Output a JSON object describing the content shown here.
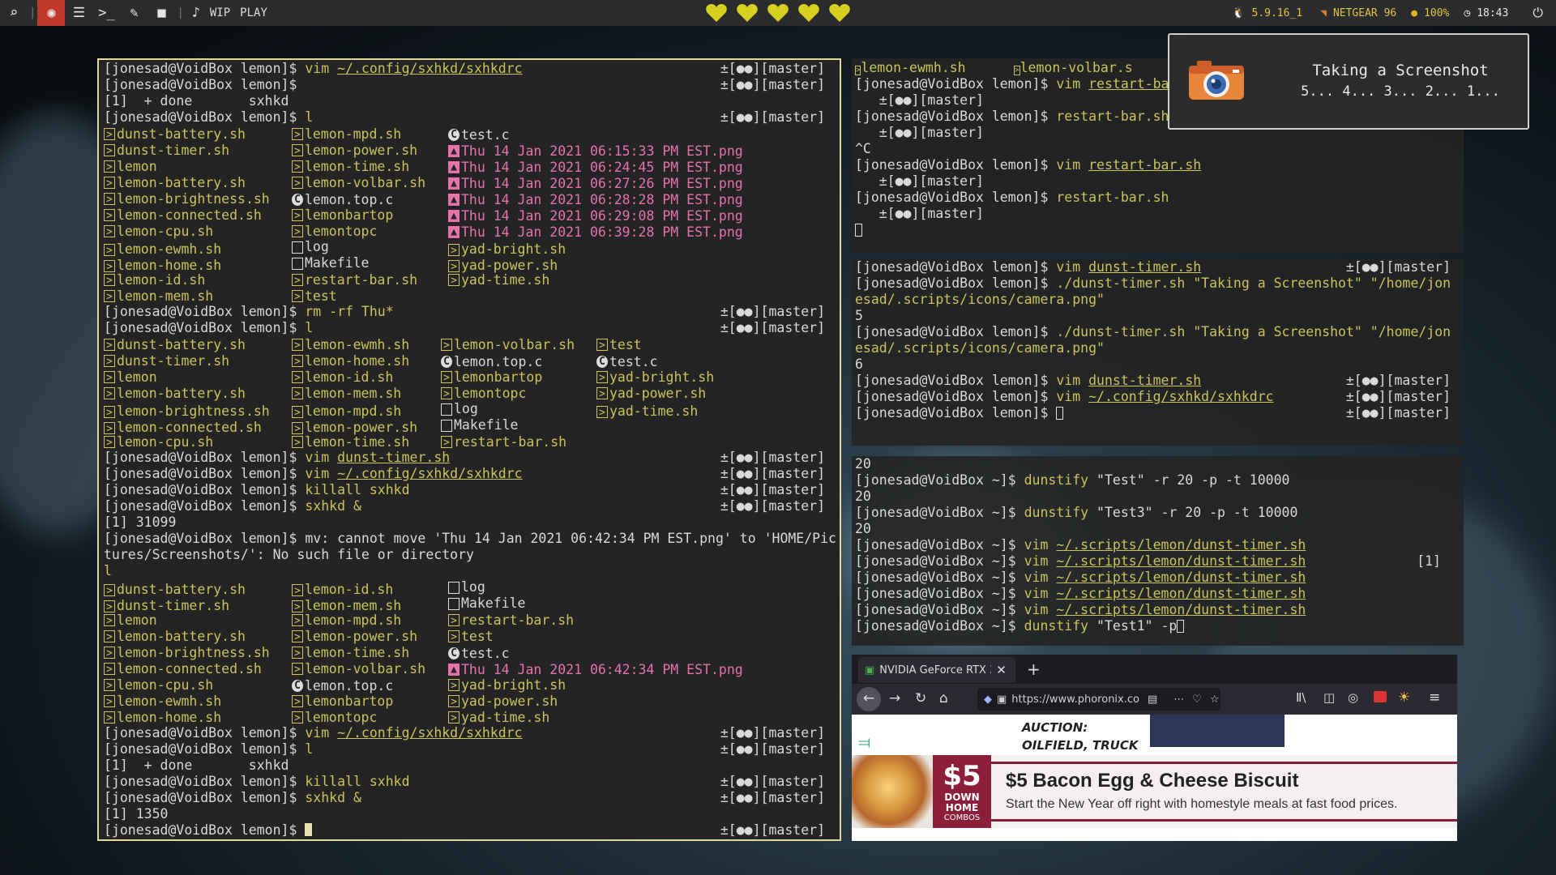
{
  "topbar": {
    "workspace_labels": [
      "WIP",
      "PLAY"
    ],
    "kernel": "5.9.16_1",
    "wifi": "NETGEAR 96",
    "battery": "100%",
    "time": "18:43",
    "hearts_count": 5,
    "accent": "#c0392b",
    "heart_color": "#d8d020"
  },
  "notification": {
    "title": "Taking a Screenshot",
    "body": "5... 4... 3... 2... 1..."
  },
  "left_terminal": {
    "prompt": "[jonesad@VoidBox lemon]$ ",
    "git": "±[●●][master]",
    "lines": [
      {
        "t": "cmd",
        "cmd": "vim",
        "arg": "~/.config/sxhkd/sxhkdrc",
        "argstyle": "ul",
        "git": true
      },
      {
        "t": "cmd",
        "cmd": "",
        "arg": "",
        "git": true
      },
      {
        "t": "out",
        "text": "[1]  + done       sxhkd"
      },
      {
        "t": "cmd",
        "cmd": "l",
        "arg": "",
        "git": true
      },
      {
        "t": "cols",
        "cells": [
          [
            "sh",
            "dunst-battery.sh"
          ],
          [
            "sh",
            "lemon-mpd.sh"
          ],
          [
            "c",
            "test.c"
          ]
        ]
      },
      {
        "t": "cols",
        "cells": [
          [
            "sh",
            "dunst-timer.sh"
          ],
          [
            "sh",
            "lemon-power.sh"
          ],
          [
            "png",
            "Thu 14 Jan 2021 06:15:33 PM EST.png"
          ]
        ]
      },
      {
        "t": "cols",
        "cells": [
          [
            "sh",
            "lemon"
          ],
          [
            "sh",
            "lemon-time.sh"
          ],
          [
            "png",
            "Thu 14 Jan 2021 06:24:45 PM EST.png"
          ]
        ]
      },
      {
        "t": "cols",
        "cells": [
          [
            "sh",
            "lemon-battery.sh"
          ],
          [
            "sh",
            "lemon-volbar.sh"
          ],
          [
            "png",
            "Thu 14 Jan 2021 06:27:26 PM EST.png"
          ]
        ]
      },
      {
        "t": "cols",
        "cells": [
          [
            "sh",
            "lemon-brightness.sh"
          ],
          [
            "c",
            "lemon.top.c"
          ],
          [
            "png",
            "Thu 14 Jan 2021 06:28:28 PM EST.png"
          ]
        ]
      },
      {
        "t": "cols",
        "cells": [
          [
            "sh",
            "lemon-connected.sh"
          ],
          [
            "sh",
            "lemonbartop"
          ],
          [
            "png",
            "Thu 14 Jan 2021 06:29:08 PM EST.png"
          ]
        ]
      },
      {
        "t": "cols",
        "cells": [
          [
            "sh",
            "lemon-cpu.sh"
          ],
          [
            "sh",
            "lemontopc"
          ],
          [
            "png",
            "Thu 14 Jan 2021 06:39:28 PM EST.png"
          ]
        ]
      },
      {
        "t": "cols",
        "cells": [
          [
            "sh",
            "lemon-ewmh.sh"
          ],
          [
            "file",
            "log"
          ],
          [
            "sh",
            "yad-bright.sh"
          ]
        ]
      },
      {
        "t": "cols",
        "cells": [
          [
            "sh",
            "lemon-home.sh"
          ],
          [
            "file",
            "Makefile"
          ],
          [
            "sh",
            "yad-power.sh"
          ]
        ]
      },
      {
        "t": "cols",
        "cells": [
          [
            "sh",
            "lemon-id.sh"
          ],
          [
            "sh",
            "restart-bar.sh"
          ],
          [
            "sh",
            "yad-time.sh"
          ]
        ]
      },
      {
        "t": "cols",
        "cells": [
          [
            "sh",
            "lemon-mem.sh"
          ],
          [
            "sh",
            "test"
          ]
        ]
      },
      {
        "t": "cmd",
        "cmd": "rm",
        "arg": "-rf Thu*",
        "argstyle": "plain",
        "git": true
      },
      {
        "t": "cmd",
        "cmd": "l",
        "arg": "",
        "git": true
      },
      {
        "t": "cols4",
        "cells": [
          [
            "sh",
            "dunst-battery.sh"
          ],
          [
            "sh",
            "lemon-ewmh.sh"
          ],
          [
            "sh",
            "lemon-volbar.sh"
          ],
          [
            "sh",
            "test"
          ]
        ]
      },
      {
        "t": "cols4",
        "cells": [
          [
            "sh",
            "dunst-timer.sh"
          ],
          [
            "sh",
            "lemon-home.sh"
          ],
          [
            "c",
            "lemon.top.c"
          ],
          [
            "c",
            "test.c"
          ]
        ]
      },
      {
        "t": "cols4",
        "cells": [
          [
            "sh",
            "lemon"
          ],
          [
            "sh",
            "lemon-id.sh"
          ],
          [
            "sh",
            "lemonbartop"
          ],
          [
            "sh",
            "yad-bright.sh"
          ]
        ]
      },
      {
        "t": "cols4",
        "cells": [
          [
            "sh",
            "lemon-battery.sh"
          ],
          [
            "sh",
            "lemon-mem.sh"
          ],
          [
            "sh",
            "lemontopc"
          ],
          [
            "sh",
            "yad-power.sh"
          ]
        ]
      },
      {
        "t": "cols4",
        "cells": [
          [
            "sh",
            "lemon-brightness.sh"
          ],
          [
            "sh",
            "lemon-mpd.sh"
          ],
          [
            "file",
            "log"
          ],
          [
            "sh",
            "yad-time.sh"
          ]
        ]
      },
      {
        "t": "cols4",
        "cells": [
          [
            "sh",
            "lemon-connected.sh"
          ],
          [
            "sh",
            "lemon-power.sh"
          ],
          [
            "file",
            "Makefile"
          ]
        ]
      },
      {
        "t": "cols4",
        "cells": [
          [
            "sh",
            "lemon-cpu.sh"
          ],
          [
            "sh",
            "lemon-time.sh"
          ],
          [
            "sh",
            "restart-bar.sh"
          ]
        ]
      },
      {
        "t": "cmd",
        "cmd": "vim",
        "arg": "dunst-timer.sh",
        "argstyle": "ul",
        "git": true
      },
      {
        "t": "cmd",
        "cmd": "vim",
        "arg": "~/.config/sxhkd/sxhkdrc",
        "argstyle": "ul",
        "git": true
      },
      {
        "t": "cmd",
        "cmd": "killall",
        "arg": "sxhkd",
        "argstyle": "plain",
        "git": true
      },
      {
        "t": "cmd",
        "cmd": "sxhkd",
        "arg": "&",
        "argstyle": "plain",
        "git": true
      },
      {
        "t": "out",
        "text": "[1] 31099"
      },
      {
        "t": "out",
        "text": "[jonesad@VoidBox lemon]$ mv: cannot move 'Thu 14 Jan 2021 06:42:34 PM EST.png' to 'HOME/Pic"
      },
      {
        "t": "out",
        "text": "tures/Screenshots/': No such file or directory"
      },
      {
        "t": "out",
        "text": "l",
        "cls": "yl"
      },
      {
        "t": "cols",
        "cells": [
          [
            "sh",
            "dunst-battery.sh"
          ],
          [
            "sh",
            "lemon-id.sh"
          ],
          [
            "file",
            "log"
          ]
        ]
      },
      {
        "t": "cols",
        "cells": [
          [
            "sh",
            "dunst-timer.sh"
          ],
          [
            "sh",
            "lemon-mem.sh"
          ],
          [
            "file",
            "Makefile"
          ]
        ]
      },
      {
        "t": "cols",
        "cells": [
          [
            "sh",
            "lemon"
          ],
          [
            "sh",
            "lemon-mpd.sh"
          ],
          [
            "sh",
            "restart-bar.sh"
          ]
        ]
      },
      {
        "t": "cols",
        "cells": [
          [
            "sh",
            "lemon-battery.sh"
          ],
          [
            "sh",
            "lemon-power.sh"
          ],
          [
            "sh",
            "test"
          ]
        ]
      },
      {
        "t": "cols",
        "cells": [
          [
            "sh",
            "lemon-brightness.sh"
          ],
          [
            "sh",
            "lemon-time.sh"
          ],
          [
            "c",
            "test.c"
          ]
        ]
      },
      {
        "t": "cols",
        "cells": [
          [
            "sh",
            "lemon-connected.sh"
          ],
          [
            "sh",
            "lemon-volbar.sh"
          ],
          [
            "png",
            "Thu 14 Jan 2021 06:42:34 PM EST.png"
          ]
        ]
      },
      {
        "t": "cols",
        "cells": [
          [
            "sh",
            "lemon-cpu.sh"
          ],
          [
            "c",
            "lemon.top.c"
          ],
          [
            "sh",
            "yad-bright.sh"
          ]
        ]
      },
      {
        "t": "cols",
        "cells": [
          [
            "sh",
            "lemon-ewmh.sh"
          ],
          [
            "sh",
            "lemonbartop"
          ],
          [
            "sh",
            "yad-power.sh"
          ]
        ]
      },
      {
        "t": "cols",
        "cells": [
          [
            "sh",
            "lemon-home.sh"
          ],
          [
            "sh",
            "lemontopc"
          ],
          [
            "sh",
            "yad-time.sh"
          ]
        ]
      },
      {
        "t": "cmd",
        "cmd": "vim",
        "arg": "~/.config/sxhkd/sxhkdrc",
        "argstyle": "ul",
        "git": true
      },
      {
        "t": "cmd",
        "cmd": "l",
        "arg": "",
        "git": true
      },
      {
        "t": "out",
        "text": "[1]  + done       sxhkd"
      },
      {
        "t": "cmd",
        "cmd": "killall",
        "arg": "sxhkd",
        "argstyle": "plain",
        "git": true
      },
      {
        "t": "cmd",
        "cmd": "sxhkd",
        "arg": "&",
        "argstyle": "plain",
        "git": true
      },
      {
        "t": "out",
        "text": "[1] 1350"
      },
      {
        "t": "cursor",
        "git": true
      }
    ]
  },
  "term_top_right": {
    "lines": [
      {
        "t": "raw",
        "segs": [
          [
            "sh-icon",
            ""
          ],
          [
            "yl",
            "lemon-ewmh.sh"
          ],
          [
            "",
            "      "
          ],
          [
            "sh-icon",
            ""
          ],
          [
            "yl",
            "lemon-volbar.s"
          ]
        ]
      },
      {
        "t": "raw",
        "segs": [
          [
            "",
            "[jonesad@VoidBox lemon]$ "
          ],
          [
            "yl",
            "vim "
          ],
          [
            "ul",
            "restart-ba"
          ]
        ]
      },
      {
        "t": "raw",
        "segs": [
          [
            "",
            "   ±[●●][master]"
          ]
        ]
      },
      {
        "t": "raw",
        "segs": [
          [
            "",
            "[jonesad@VoidBox lemon]$ "
          ],
          [
            "yl",
            "restart-bar.sh"
          ]
        ]
      },
      {
        "t": "raw",
        "segs": [
          [
            "",
            "   ±[●●][master]"
          ]
        ]
      },
      {
        "t": "raw",
        "segs": [
          [
            "",
            "^C"
          ]
        ]
      },
      {
        "t": "raw",
        "segs": [
          [
            "",
            "[jonesad@VoidBox lemon]$ "
          ],
          [
            "yl",
            "vim "
          ],
          [
            "ul",
            "restart-bar.sh"
          ]
        ]
      },
      {
        "t": "raw",
        "segs": [
          [
            "",
            "   ±[●●][master]"
          ]
        ]
      },
      {
        "t": "raw",
        "segs": [
          [
            "",
            "[jonesad@VoidBox lemon]$ "
          ],
          [
            "yl",
            "restart-bar.sh"
          ]
        ]
      },
      {
        "t": "raw",
        "segs": [
          [
            "",
            "   ±[●●][master]"
          ]
        ]
      },
      {
        "t": "raw",
        "segs": [
          [
            "curo",
            ""
          ]
        ]
      }
    ]
  },
  "term_mid_right": {
    "lines": [
      {
        "t": "raw",
        "segs": [
          [
            "",
            "[jonesad@VoidBox lemon]$ "
          ],
          [
            "yl",
            "vim "
          ],
          [
            "ul",
            "dunst-timer.sh"
          ]
        ],
        "git": true
      },
      {
        "t": "raw",
        "segs": [
          [
            "",
            "[jonesad@VoidBox lemon]$ "
          ],
          [
            "yl",
            "./dunst-timer.sh \"Taking a Screenshot\" \"/home/jon"
          ]
        ]
      },
      {
        "t": "raw",
        "segs": [
          [
            "yl",
            "esad/.scripts/icons/camera.png\""
          ]
        ]
      },
      {
        "t": "raw",
        "segs": [
          [
            "",
            "5"
          ]
        ]
      },
      {
        "t": "raw",
        "segs": [
          [
            "",
            "[jonesad@VoidBox lemon]$ "
          ],
          [
            "yl",
            "./dunst-timer.sh \"Taking a Screenshot\" \"/home/jon"
          ]
        ]
      },
      {
        "t": "raw",
        "segs": [
          [
            "yl",
            "esad/.scripts/icons/camera.png\""
          ]
        ]
      },
      {
        "t": "raw",
        "segs": [
          [
            "",
            "6"
          ]
        ]
      },
      {
        "t": "raw",
        "segs": [
          [
            "",
            "[jonesad@VoidBox lemon]$ "
          ],
          [
            "yl",
            "vim "
          ],
          [
            "ul",
            "dunst-timer.sh"
          ]
        ],
        "git": true
      },
      {
        "t": "raw",
        "segs": [
          [
            "",
            "[jonesad@VoidBox lemon]$ "
          ],
          [
            "yl",
            "vim "
          ],
          [
            "ul",
            "~/.config/sxhkd/sxhkdrc"
          ]
        ],
        "git": true
      },
      {
        "t": "raw",
        "segs": [
          [
            "",
            "[jonesad@VoidBox lemon]$ "
          ],
          [
            "curo",
            ""
          ]
        ],
        "git": true
      }
    ]
  },
  "term_bottom_right": {
    "lines": [
      {
        "t": "raw",
        "segs": [
          [
            "",
            "20"
          ]
        ]
      },
      {
        "t": "raw",
        "segs": [
          [
            "",
            "[jonesad@VoidBox ~]$ "
          ],
          [
            "yl",
            "dunstify "
          ],
          [
            "",
            "\"Test\" -r 20 -p -t 10000"
          ]
        ]
      },
      {
        "t": "raw",
        "segs": [
          [
            "",
            "20"
          ]
        ]
      },
      {
        "t": "raw",
        "segs": [
          [
            "",
            "[jonesad@VoidBox ~]$ "
          ],
          [
            "yl",
            "dunstify "
          ],
          [
            "",
            "\"Test3\" -r 20 -p -t 10000"
          ]
        ]
      },
      {
        "t": "raw",
        "segs": [
          [
            "",
            "20"
          ]
        ]
      },
      {
        "t": "raw",
        "segs": [
          [
            "",
            "[jonesad@VoidBox ~]$ "
          ],
          [
            "yl",
            "vim "
          ],
          [
            "ul",
            "~/.scripts/lemon/dunst-timer.sh"
          ]
        ]
      },
      {
        "t": "raw",
        "segs": [
          [
            "",
            "[jonesad@VoidBox ~]$ "
          ],
          [
            "yl",
            "vim "
          ],
          [
            "ul",
            "~/.scripts/lemon/dunst-timer.sh"
          ]
        ],
        "extra": "[1]"
      },
      {
        "t": "raw",
        "segs": [
          [
            "",
            "[jonesad@VoidBox ~]$ "
          ],
          [
            "yl",
            "vim "
          ],
          [
            "ul",
            "~/.scripts/lemon/dunst-timer.sh"
          ]
        ]
      },
      {
        "t": "raw",
        "segs": [
          [
            "",
            "[jonesad@VoidBox ~]$ "
          ],
          [
            "yl",
            "vim "
          ],
          [
            "ul",
            "~/.scripts/lemon/dunst-timer.sh"
          ]
        ]
      },
      {
        "t": "raw",
        "segs": [
          [
            "",
            "[jonesad@VoidBox ~]$ "
          ],
          [
            "yl",
            "vim "
          ],
          [
            "ul",
            "~/.scripts/lemon/dunst-timer.sh"
          ]
        ]
      },
      {
        "t": "raw",
        "segs": [
          [
            "",
            "[jonesad@VoidBox ~]$ "
          ],
          [
            "yl",
            "dunstify "
          ],
          [
            "",
            "\"Test1\" -p"
          ],
          [
            "curo",
            ""
          ]
        ]
      }
    ]
  },
  "browser": {
    "tab_title": "NVIDIA GeForce RTX 3",
    "url": "https://www.phoronix.co",
    "ad_top_text": [
      "AUCTION:",
      "OILFIELD, TRUCK"
    ],
    "ad_price": "$5",
    "ad_sub": [
      "DOWN",
      "HOME",
      "COMBOS"
    ],
    "ad_title": "$5 Bacon Egg & Cheese Biscuit",
    "ad_desc": "Start the New Year off right with homestyle meals at fast food prices."
  }
}
